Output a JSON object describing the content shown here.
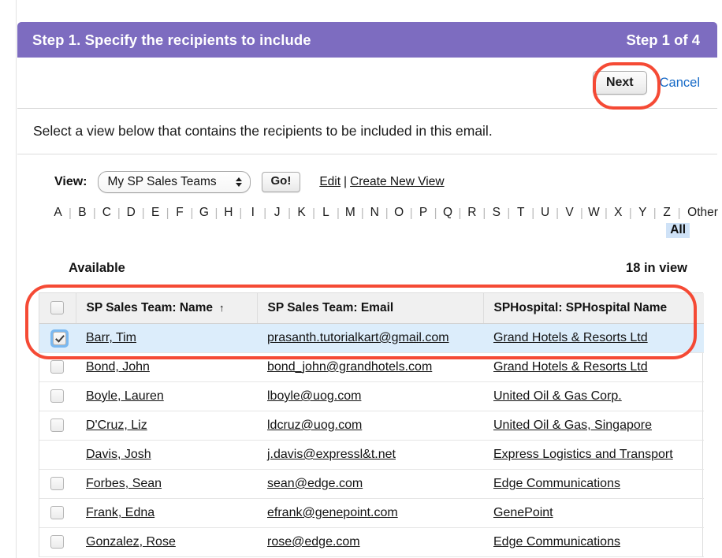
{
  "header": {
    "title": "Step 1. Specify the recipients to include",
    "counter": "Step 1 of 4",
    "background_color": "#7D6CC0"
  },
  "action_bar": {
    "next_label": "Next",
    "cancel_label": "Cancel",
    "cancel_color": "#1569C7"
  },
  "instruction": {
    "text": "Select a view below that contains the recipients to be included in this email."
  },
  "view_row": {
    "label": "View:",
    "selected_view": "My SP Sales Teams",
    "go_label": "Go!",
    "edit_label": "Edit",
    "separator": "|",
    "create_label": "Create New View"
  },
  "alpha_filter": {
    "letters": [
      "A",
      "B",
      "C",
      "D",
      "E",
      "F",
      "G",
      "H",
      "I",
      "J",
      "K",
      "L",
      "M",
      "N",
      "O",
      "P",
      "Q",
      "R",
      "S",
      "T",
      "U",
      "V",
      "W",
      "X",
      "Y",
      "Z"
    ],
    "other_label": "Other",
    "all_label": "All",
    "all_highlight_color": "#cfe2f7",
    "divider": "|"
  },
  "list_meta": {
    "available_label": "Available",
    "in_view_count": "18 in view"
  },
  "table": {
    "columns": [
      {
        "key": "check",
        "label": ""
      },
      {
        "key": "name",
        "label": "SP Sales Team: Name",
        "sorted": true,
        "sort_arrow": "↑"
      },
      {
        "key": "email",
        "label": "SP Sales Team: Email"
      },
      {
        "key": "hospital",
        "label": "SPHospital: SPHospital Name"
      }
    ],
    "header_checkbox_checked": false,
    "rows": [
      {
        "checkbox": true,
        "checked": true,
        "focused": true,
        "selected": true,
        "name": "Barr, Tim",
        "email": "prasanth.tutorialkart@gmail.com",
        "hospital": "Grand Hotels & Resorts Ltd"
      },
      {
        "checkbox": true,
        "checked": false,
        "focused": false,
        "selected": false,
        "name": "Bond, John",
        "email": "bond_john@grandhotels.com",
        "hospital": "Grand Hotels & Resorts Ltd"
      },
      {
        "checkbox": true,
        "checked": false,
        "focused": false,
        "selected": false,
        "name": "Boyle, Lauren",
        "email": "lboyle@uog.com",
        "hospital": "United Oil & Gas Corp."
      },
      {
        "checkbox": true,
        "checked": false,
        "focused": false,
        "selected": false,
        "name": "D'Cruz, Liz",
        "email": "ldcruz@uog.com",
        "hospital": "United Oil & Gas, Singapore"
      },
      {
        "checkbox": false,
        "checked": false,
        "focused": false,
        "selected": false,
        "name": "Davis, Josh",
        "email": "j.davis@expressl&t.net",
        "hospital": "Express Logistics and Transport"
      },
      {
        "checkbox": true,
        "checked": false,
        "focused": false,
        "selected": false,
        "name": "Forbes, Sean",
        "email": "sean@edge.com",
        "hospital": "Edge Communications"
      },
      {
        "checkbox": true,
        "checked": false,
        "focused": false,
        "selected": false,
        "name": "Frank, Edna",
        "email": "efrank@genepoint.com",
        "hospital": "GenePoint"
      },
      {
        "checkbox": true,
        "checked": false,
        "focused": false,
        "selected": false,
        "name": "Gonzalez, Rose",
        "email": "rose@edge.com",
        "hospital": "Edge Communications"
      }
    ]
  },
  "annotations": {
    "color": "#F4402A",
    "shapes": [
      {
        "name": "next-button-highlight",
        "target": "next-button"
      },
      {
        "name": "first-row-highlight",
        "target": "table-first-row"
      }
    ]
  }
}
